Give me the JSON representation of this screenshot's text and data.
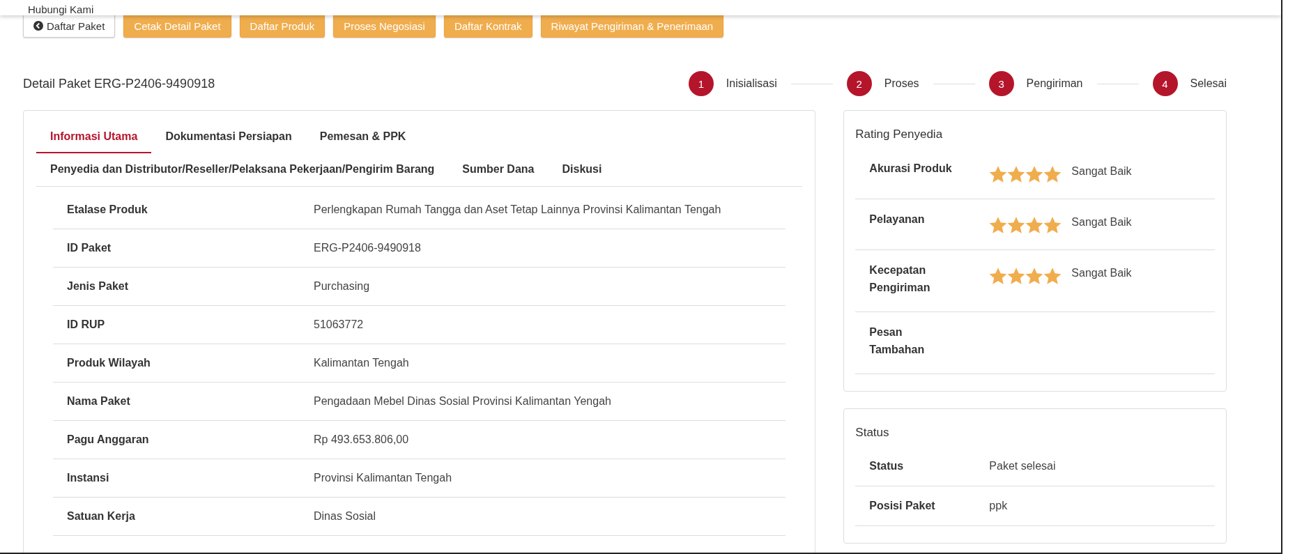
{
  "header": {
    "link": "Hubungi Kami"
  },
  "actions": [
    {
      "label": "Daftar Paket",
      "kind": "back"
    },
    {
      "label": "Cetak Detail Paket",
      "kind": "warning"
    },
    {
      "label": "Daftar Produk",
      "kind": "warning"
    },
    {
      "label": "Proses Negosiasi",
      "kind": "warning"
    },
    {
      "label": "Daftar Kontrak",
      "kind": "warning"
    },
    {
      "label": "Riwayat Pengiriman & Penerimaan",
      "kind": "warning"
    }
  ],
  "title": "Detail Paket ERG-P2406-9490918",
  "steps": [
    {
      "number": "1",
      "label": "Inisialisasi"
    },
    {
      "number": "2",
      "label": "Proses"
    },
    {
      "number": "3",
      "label": "Pengiriman"
    },
    {
      "number": "4",
      "label": "Selesai"
    }
  ],
  "tabs": [
    [
      {
        "label": "Informasi Utama",
        "selected": true
      },
      {
        "label": "Dokumentasi Persiapan",
        "selected": false
      },
      {
        "label": "Pemesan & PPK",
        "selected": false
      }
    ],
    [
      {
        "label": "Penyedia dan Distributor/Reseller/Pelaksana Pekerjaan/Pengirim Barang",
        "selected": false
      },
      {
        "label": "Sumber Dana",
        "selected": false
      },
      {
        "label": "Diskusi",
        "selected": false
      }
    ]
  ],
  "details": [
    {
      "label": "Etalase Produk",
      "value": "Perlengkapan Rumah Tangga dan Aset Tetap Lainnya Provinsi Kalimantan Tengah"
    },
    {
      "label": "ID Paket",
      "value": "ERG-P2406-9490918"
    },
    {
      "label": "Jenis Paket",
      "value": "Purchasing"
    },
    {
      "label": "ID RUP",
      "value": "51063772"
    },
    {
      "label": "Produk Wilayah",
      "value": "Kalimantan Tengah"
    },
    {
      "label": "Nama Paket",
      "value": "Pengadaan Mebel Dinas Sosial Provinsi Kalimantan Yengah"
    },
    {
      "label": "Pagu Anggaran",
      "value": "Rp 493.653.806,00"
    },
    {
      "label": "Instansi",
      "value": "Provinsi Kalimantan Tengah"
    },
    {
      "label": "Satuan Kerja",
      "value": "Dinas Sosial"
    }
  ],
  "rating": {
    "title": "Rating Penyedia",
    "rows": [
      {
        "label": "Akurasi Produk",
        "stars": 4,
        "text": "Sangat Baik"
      },
      {
        "label": "Pelayanan",
        "stars": 4,
        "text": "Sangat Baik"
      },
      {
        "label": "Kecepatan Pengiriman",
        "stars": 4,
        "text": "Sangat Baik"
      },
      {
        "label": "Pesan Tambahan"
      }
    ]
  },
  "status": {
    "title": "Status",
    "rows": [
      {
        "label": "Status",
        "value": "Paket selesai"
      },
      {
        "label": "Posisi Paket",
        "value": "ppk"
      }
    ]
  }
}
